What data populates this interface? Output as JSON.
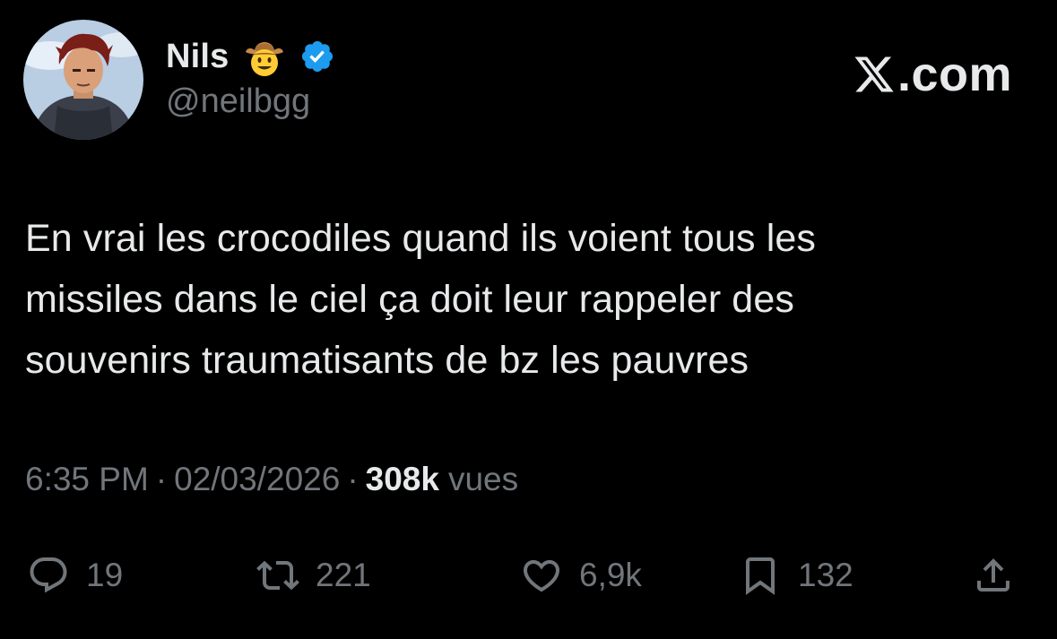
{
  "author": {
    "display_name": "Nils",
    "handle": "@neilbgg",
    "name_emoji": "cowboy-hat-face-emoji",
    "verified": true
  },
  "brand": {
    "label": ".com",
    "logo": "x-logo-icon"
  },
  "tweet": {
    "text": "En vrai les crocodiles quand ils voient tous les\nmissiles dans le ciel ça doit leur rappeler des\nsouvenirs traumatisants de bz les pauvres"
  },
  "meta": {
    "time": "6:35 PM",
    "separator": "·",
    "date": "02/03/2026",
    "views_count": "308k",
    "views_label": "vues"
  },
  "actions": {
    "replies": "19",
    "reposts": "221",
    "likes": "6,9k",
    "bookmarks": "132"
  },
  "colors": {
    "background": "#000000",
    "primary_text": "#e7e9ea",
    "secondary_text": "#71767b",
    "verified_blue": "#1d9bf0"
  }
}
